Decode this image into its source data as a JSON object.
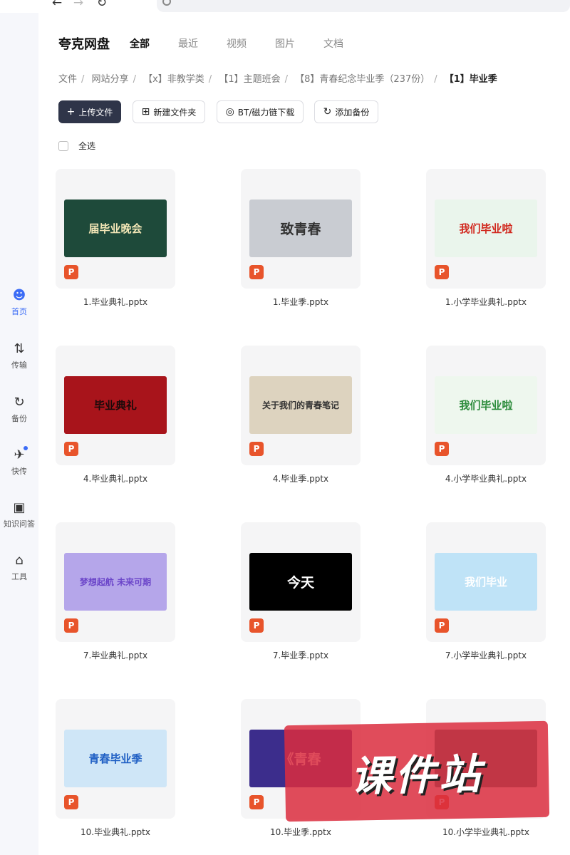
{
  "app": {
    "brand": "夸克网盘",
    "tabs": [
      "全部",
      "最近",
      "视频",
      "图片",
      "文档"
    ],
    "active_tab": "全部"
  },
  "sidebar": [
    {
      "label": "首页",
      "icon": "home-icon",
      "active": true
    },
    {
      "label": "传输",
      "icon": "transfer-icon",
      "active": false
    },
    {
      "label": "备份",
      "icon": "backup-icon",
      "active": false
    },
    {
      "label": "快传",
      "icon": "quick-send-icon",
      "active": false,
      "badge": true
    },
    {
      "label": "知识问答",
      "icon": "knowledge-qa-icon",
      "active": false
    },
    {
      "label": "工具",
      "icon": "tools-icon",
      "active": false
    }
  ],
  "breadcrumb": [
    "文件",
    "网站分享",
    "【x】非教学类",
    "【1】主题班会",
    "【8】青春纪念毕业季（237份）",
    "【1】毕业季"
  ],
  "toolbar": {
    "upload": "上传文件",
    "new_folder": "新建文件夹",
    "bt_download": "BT/磁力链下载",
    "add_backup": "添加备份",
    "select_all": "全选"
  },
  "files": [
    {
      "name": "1.毕业典礼.pptx",
      "thumb_text": "届毕业晚会",
      "bg": "#1e4a3a",
      "fg": "#f2e6b6"
    },
    {
      "name": "1.毕业季.pptx",
      "thumb_text": "致青春",
      "bg": "#c9ccd2",
      "fg": "#333333"
    },
    {
      "name": "1.小学毕业典礼.pptx",
      "thumb_text": "我们毕业啦",
      "bg": "#eaf5ec",
      "fg": "#d1281e"
    },
    {
      "name": "4.毕业典礼.pptx",
      "thumb_text": "毕业典礼",
      "bg": "#a8141b",
      "fg": "#1a0a0a"
    },
    {
      "name": "4.毕业季.pptx",
      "thumb_text": "关于我们的青春笔记",
      "bg": "#ddd3bf",
      "fg": "#333333"
    },
    {
      "name": "4.小学毕业典礼.pptx",
      "thumb_text": "我们毕业啦",
      "bg": "#eef7ee",
      "fg": "#2d8c3c"
    },
    {
      "name": "7.毕业典礼.pptx",
      "thumb_text": "梦想起航 未来可期",
      "bg": "#b5a6ea",
      "fg": "#6b45c9"
    },
    {
      "name": "7.毕业季.pptx",
      "thumb_text": "今天",
      "bg": "#000000",
      "fg": "#ffffff"
    },
    {
      "name": "7.小学毕业典礼.pptx",
      "thumb_text": "我们毕业",
      "bg": "#bfe3f7",
      "fg": "#ffffff"
    },
    {
      "name": "10.毕业典礼.pptx",
      "thumb_text": "青春毕业季",
      "bg": "#cfe6f7",
      "fg": "#1f5fc4"
    },
    {
      "name": "10.毕业季.pptx",
      "thumb_text": "《青春",
      "bg": "#3c2d8c",
      "fg": "#ffffff"
    },
    {
      "name": "10.小学毕业典礼.pptx",
      "thumb_text": "",
      "bg": "#2f6e6e",
      "fg": "#ffffff"
    }
  ],
  "file_icon_letter": "P",
  "watermark": "课件站"
}
